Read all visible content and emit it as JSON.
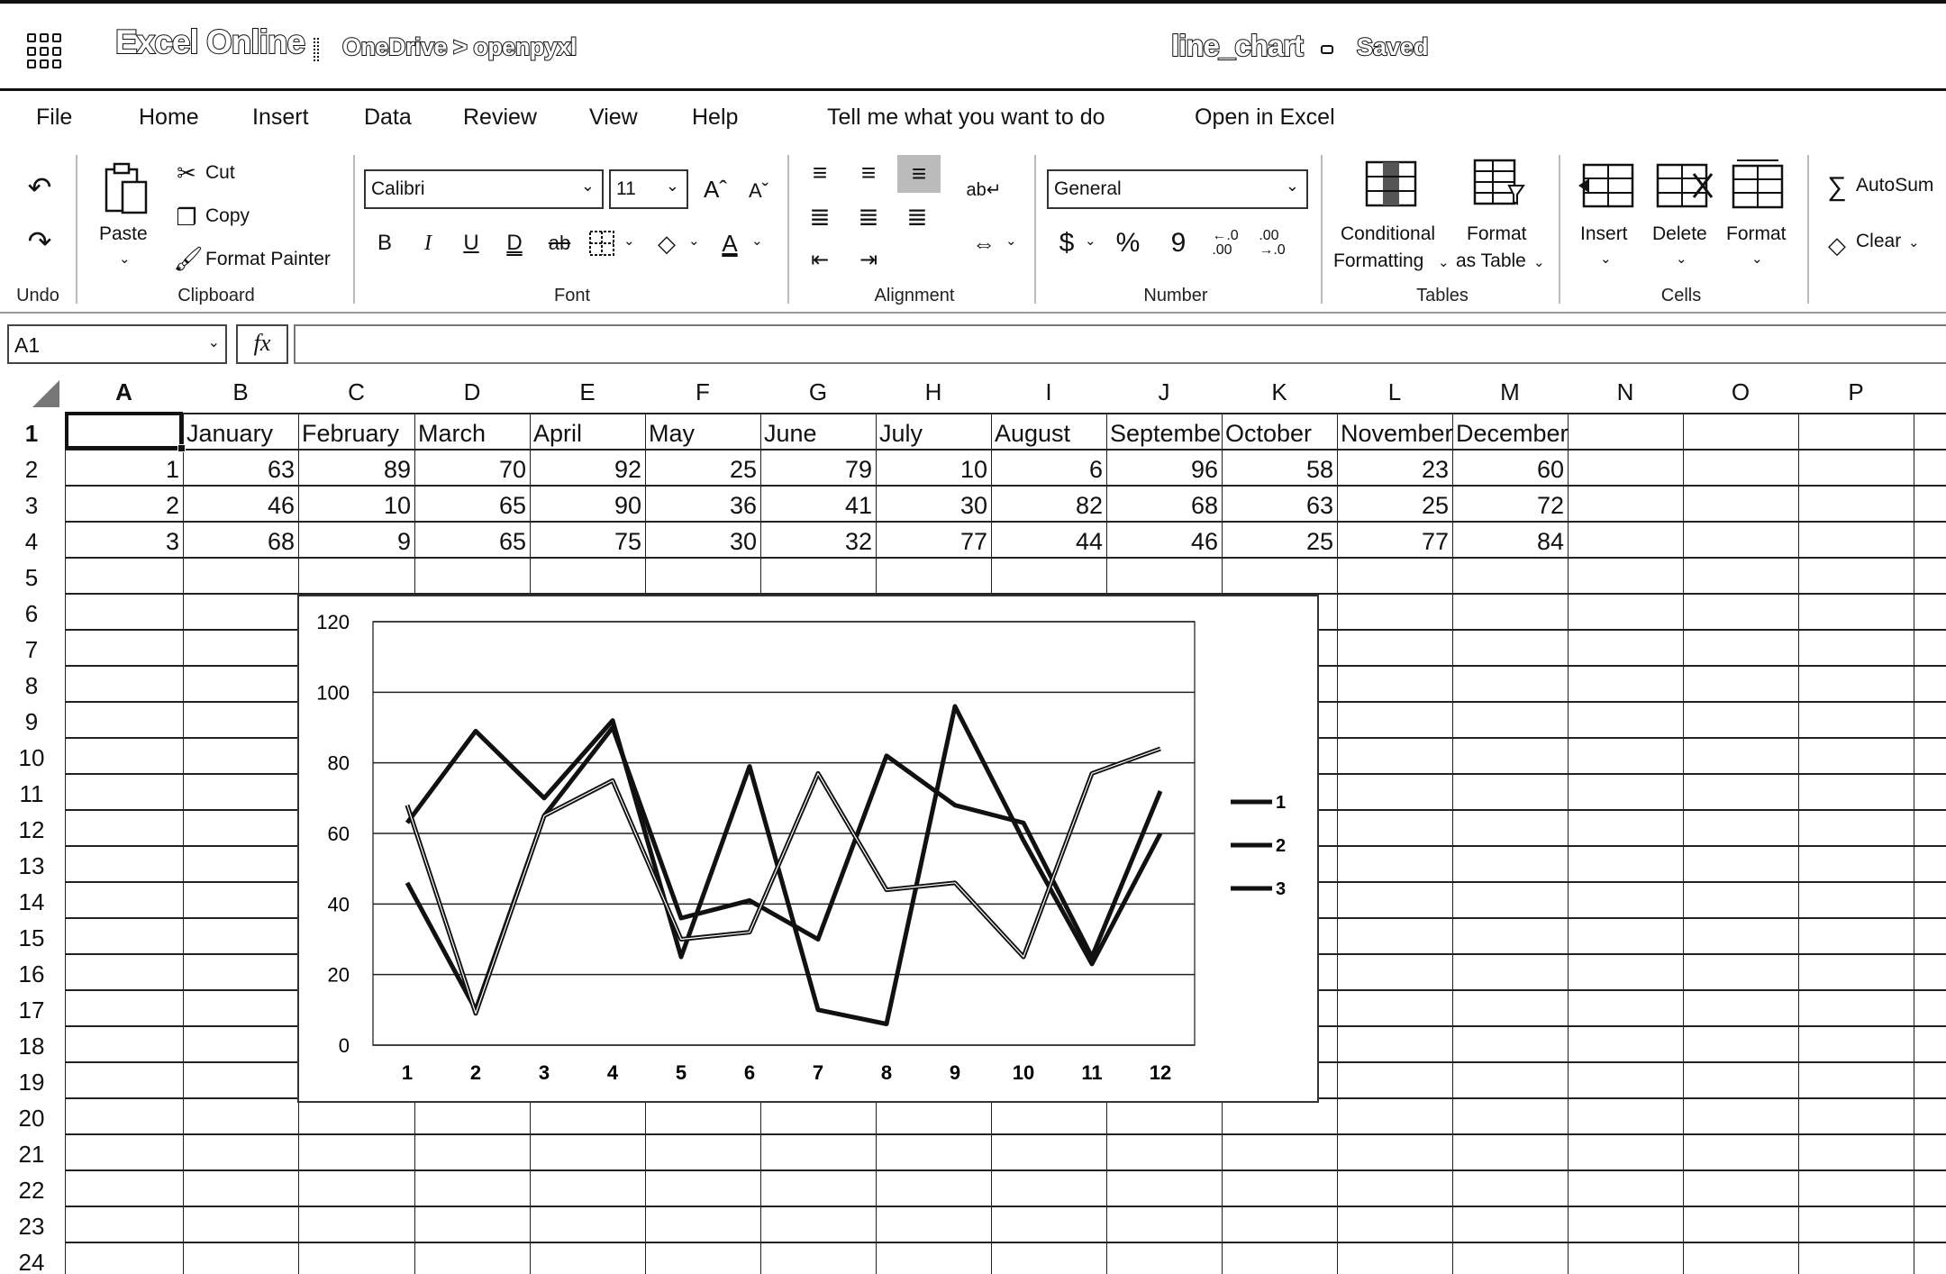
{
  "titlebar": {
    "app_name": "Excel Online",
    "breadcrumb": "OneDrive > openpyxl",
    "doc_title": "line_chart",
    "status": "Saved"
  },
  "tabs": [
    "File",
    "Home",
    "Insert",
    "Data",
    "Review",
    "View",
    "Help",
    "Tell me what you want to do",
    "Open in Excel"
  ],
  "ribbon": {
    "undo_group": "Undo",
    "paste": "Paste",
    "cut": "Cut",
    "copy": "Copy",
    "format_painter": "Format Painter",
    "clipboard_group": "Clipboard",
    "font_name": "Calibri",
    "font_size": "11",
    "font_group": "Font",
    "alignment_group": "Alignment",
    "number_format": "General",
    "number_group": "Number",
    "conditional_formatting_1": "Conditional",
    "conditional_formatting_2": "Formatting",
    "format_as_table_1": "Format",
    "format_as_table_2": "as Table",
    "tables_group": "Tables",
    "insert": "Insert",
    "delete": "Delete",
    "format": "Format",
    "cells_group": "Cells",
    "autosum": "AutoSum",
    "clear": "Clear"
  },
  "formula_bar": {
    "name_box": "A1",
    "fx": "fx",
    "formula": ""
  },
  "sheet": {
    "columns": [
      "A",
      "B",
      "C",
      "D",
      "E",
      "F",
      "G",
      "H",
      "I",
      "J",
      "K",
      "L",
      "M",
      "N",
      "O",
      "P"
    ],
    "rows": [
      "1",
      "2",
      "3",
      "4",
      "5",
      "6",
      "7",
      "8",
      "9",
      "10",
      "11",
      "12",
      "13",
      "14",
      "15",
      "16",
      "17",
      "18",
      "19",
      "20",
      "21",
      "22",
      "23",
      "24"
    ],
    "header_row": [
      "",
      "January",
      "February",
      "March",
      "April",
      "May",
      "June",
      "July",
      "August",
      "September",
      "October",
      "November",
      "December"
    ],
    "data_rows": [
      [
        "1",
        "63",
        "89",
        "70",
        "92",
        "25",
        "79",
        "10",
        "6",
        "96",
        "58",
        "23",
        "60"
      ],
      [
        "2",
        "46",
        "10",
        "65",
        "90",
        "36",
        "41",
        "30",
        "82",
        "68",
        "63",
        "25",
        "72"
      ],
      [
        "3",
        "68",
        "9",
        "65",
        "75",
        "30",
        "32",
        "77",
        "44",
        "46",
        "25",
        "77",
        "84"
      ]
    ]
  },
  "chart_data": {
    "type": "line",
    "categories": [
      "1",
      "2",
      "3",
      "4",
      "5",
      "6",
      "7",
      "8",
      "9",
      "10",
      "11",
      "12"
    ],
    "series": [
      {
        "name": "1",
        "values": [
          63,
          89,
          70,
          92,
          25,
          79,
          10,
          6,
          96,
          58,
          23,
          60
        ]
      },
      {
        "name": "2",
        "values": [
          46,
          10,
          65,
          90,
          36,
          41,
          30,
          82,
          68,
          63,
          25,
          72
        ]
      },
      {
        "name": "3",
        "values": [
          68,
          9,
          65,
          75,
          30,
          32,
          77,
          44,
          46,
          25,
          77,
          84
        ]
      }
    ],
    "yticks": [
      "0",
      "20",
      "40",
      "60",
      "80",
      "100",
      "120"
    ],
    "ylim": [
      0,
      120
    ],
    "grid": true,
    "legend": "right",
    "title": "",
    "xlabel": "",
    "ylabel": ""
  }
}
